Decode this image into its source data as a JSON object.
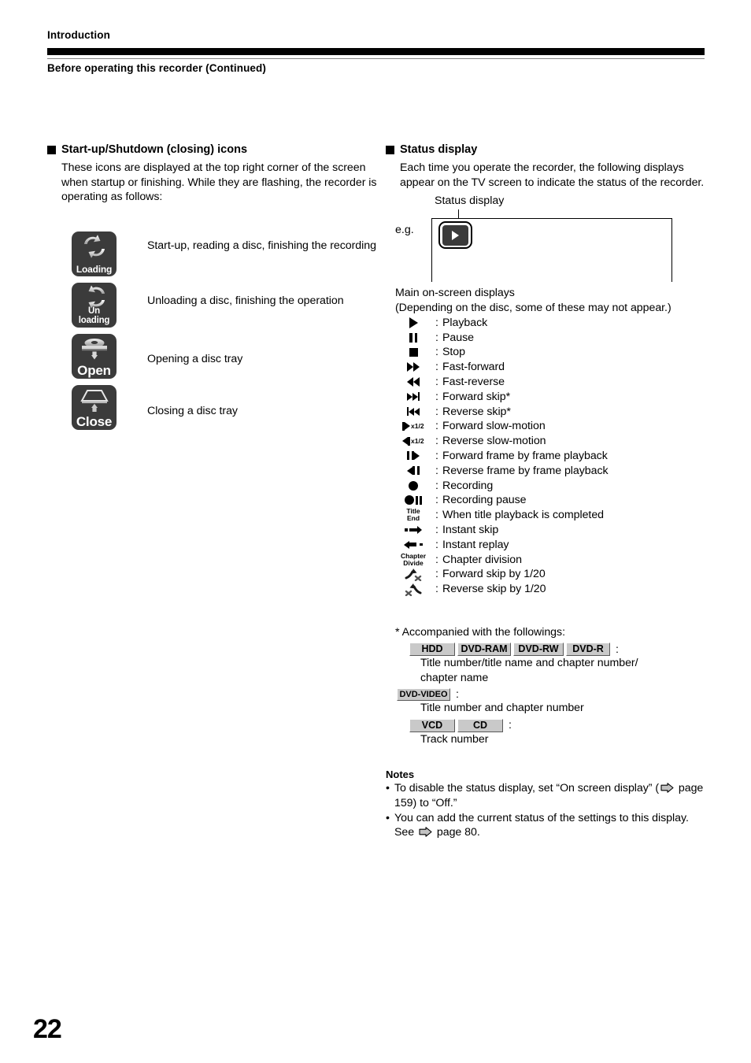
{
  "header": {
    "kicker": "Introduction",
    "title": "Before operating this recorder (Continued)"
  },
  "page_number": "22",
  "left": {
    "section_title": "Start-up/Shutdown (closing) icons",
    "intro": "These icons are displayed at the top right corner of the screen when startup or finishing. While they are flashing, the recorder is operating as follows:",
    "icons": [
      {
        "caption": "Loading",
        "caption_line2": "",
        "glyph": "two-arrows-circular-loading-icon",
        "desc": "Start-up, reading a disc, finishing the recording"
      },
      {
        "caption": "Un",
        "caption_line2": "loading",
        "glyph": "two-arrows-circular-unloading-icon",
        "desc": "Unloading a disc, finishing the operation"
      },
      {
        "caption": "Open",
        "caption_line2": "",
        "glyph": "disc-tray-down-arrow-icon",
        "desc": "Opening a disc tray"
      },
      {
        "caption": "Close",
        "caption_line2": "",
        "glyph": "disc-tray-up-arrow-icon",
        "desc": "Closing a disc tray"
      }
    ]
  },
  "right": {
    "section_title": "Status display",
    "intro": "Each time you operate the recorder, the following displays appear on the TV screen to indicate the status of the recorder.",
    "diagram": {
      "callout_label": "Status display",
      "eg_label": "e.g.",
      "badge_glyph": "play-triangle-icon"
    },
    "mosd_title": "Main on-screen displays",
    "mosd_note": "(Depending on the disc, some of these may not appear.)",
    "symbols": [
      {
        "glyph": "play-icon",
        "colon": ":",
        "label": "Playback"
      },
      {
        "glyph": "pause-icon",
        "colon": ":",
        "label": "Pause"
      },
      {
        "glyph": "stop-icon",
        "colon": ":",
        "label": "Stop"
      },
      {
        "glyph": "fast-forward-icon",
        "colon": ":",
        "label": "Fast-forward"
      },
      {
        "glyph": "fast-reverse-icon",
        "colon": ":",
        "label": "Fast-reverse"
      },
      {
        "glyph": "forward-skip-icon",
        "colon": ":",
        "label": "Forward skip*"
      },
      {
        "glyph": "reverse-skip-icon",
        "colon": ":",
        "label": "Reverse skip*"
      },
      {
        "glyph": "forward-slow-motion-icon",
        "colon": ":",
        "label": "Forward slow-motion",
        "sub": "x1/2"
      },
      {
        "glyph": "reverse-slow-motion-icon",
        "colon": ":",
        "label": "Reverse slow-motion",
        "sub": "x1/2"
      },
      {
        "glyph": "forward-frame-step-icon",
        "colon": ":",
        "label": "Forward frame by frame playback"
      },
      {
        "glyph": "reverse-frame-step-icon",
        "colon": ":",
        "label": "Reverse frame by frame playback"
      },
      {
        "glyph": "record-icon",
        "colon": ":",
        "label": "Recording"
      },
      {
        "glyph": "record-pause-icon",
        "colon": ":",
        "label": "Recording pause"
      },
      {
        "glyph": "title-end-icon",
        "colon": ":",
        "label": "When title playback is completed",
        "text1": "Title",
        "text2": "End"
      },
      {
        "glyph": "instant-skip-icon",
        "colon": ":",
        "label": "Instant skip"
      },
      {
        "glyph": "instant-replay-icon",
        "colon": ":",
        "label": "Instant replay"
      },
      {
        "glyph": "chapter-divide-icon",
        "colon": ":",
        "label": "Chapter division",
        "text1": "Chapter",
        "text2": "Divide"
      },
      {
        "glyph": "forward-skip-20th-icon",
        "colon": ":",
        "label": "Forward skip by 1/20"
      },
      {
        "glyph": "reverse-skip-20th-icon",
        "colon": ":",
        "label": "Reverse skip by 1/20"
      }
    ],
    "footnote": {
      "lead": "* Accompanied with the followings:",
      "groups": [
        {
          "badges": [
            "HDD",
            "DVD-RAM",
            "DVD-RW",
            "DVD-R"
          ],
          "colon": ":",
          "text_line1": "Title number/title name and chapter number/",
          "text_line2": "chapter name"
        },
        {
          "badges": [
            "DVD-VIDEO"
          ],
          "colon": ":",
          "text_line1": "Title number and chapter number",
          "text_line2": ""
        },
        {
          "badges": [
            "VCD",
            "CD"
          ],
          "colon": ":",
          "text_line1": "Track  number",
          "text_line2": ""
        }
      ]
    },
    "notes": {
      "heading": "Notes",
      "items": [
        {
          "bullet": "•",
          "part1": "To disable the status display, set “On screen display” (",
          "arrow": "page-arrow-icon",
          "part2": " page 159) to “Off.”"
        },
        {
          "bullet": "•",
          "part1": "You can add the current status of the settings to this display. See ",
          "arrow": "page-arrow-icon",
          "part2": " page 80."
        }
      ]
    }
  },
  "colors": {
    "icon_background": "#3b3b3b",
    "badge_fill": "#c9c9c9",
    "rule": "#808080",
    "ink": "#000000"
  }
}
